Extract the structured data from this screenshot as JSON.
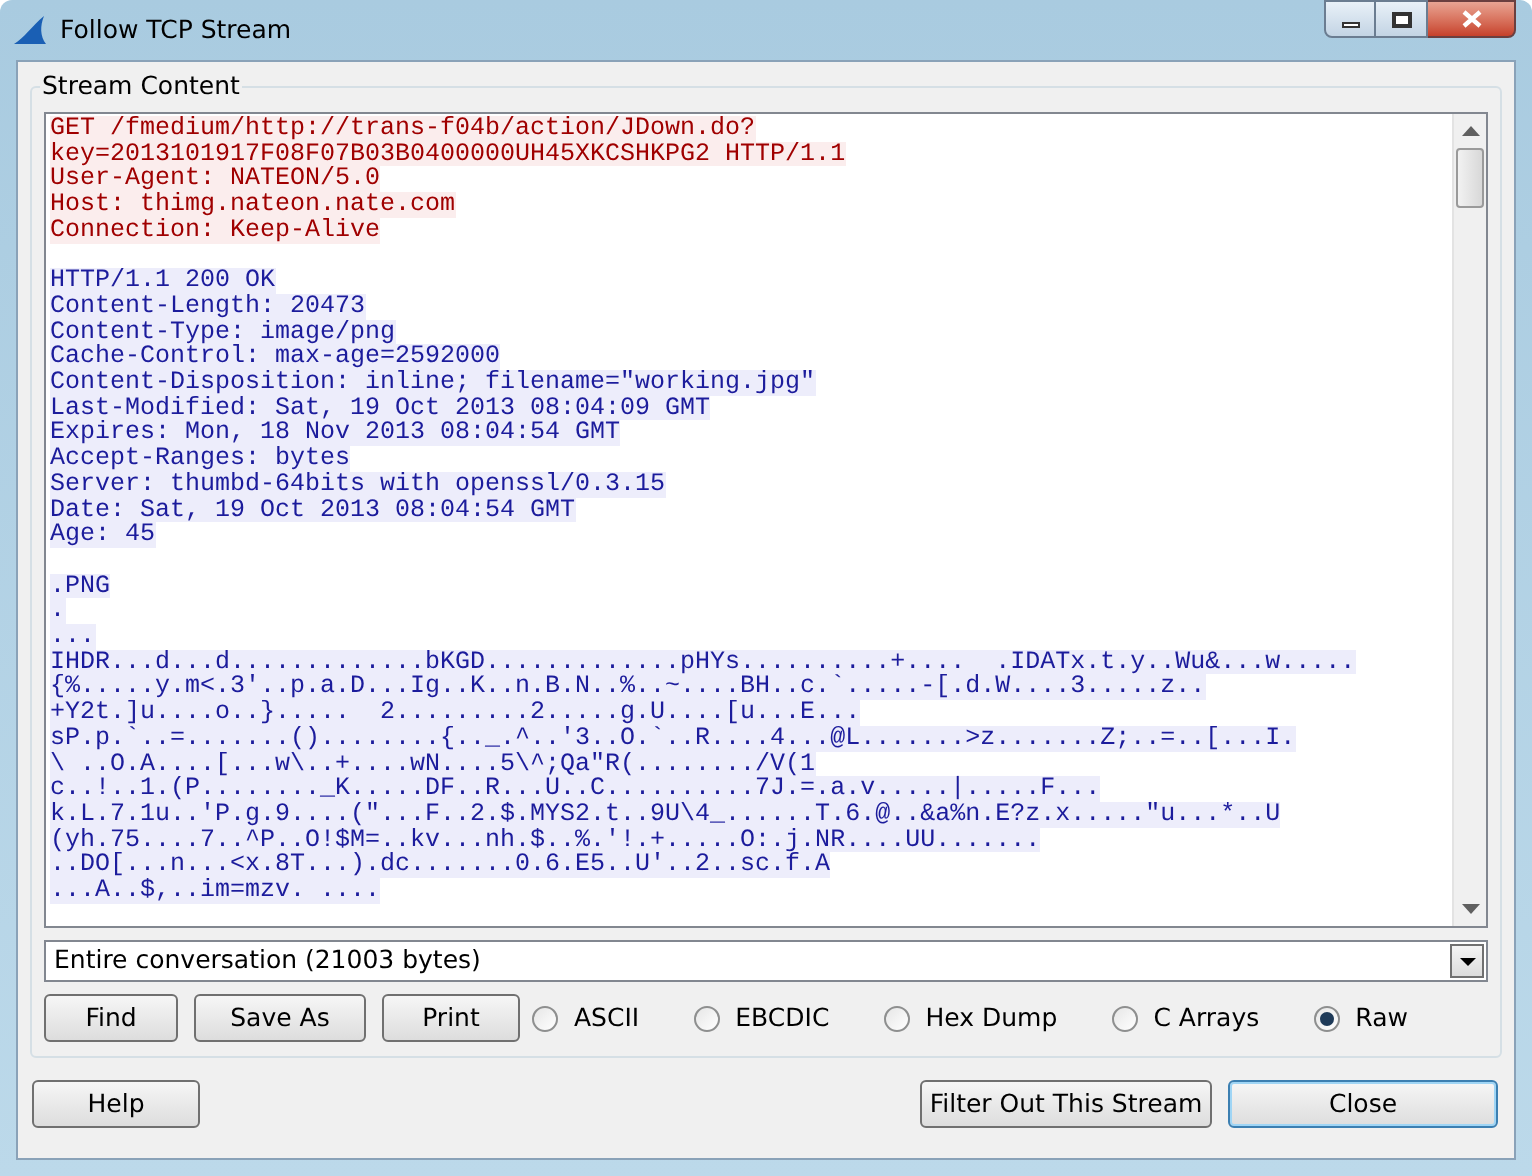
{
  "window": {
    "title": "Follow TCP Stream"
  },
  "stream_content": {
    "title": "Stream Content",
    "segments": [
      {
        "kind": "client",
        "lines": [
          "GET /fmedium/http://trans-f04b/action/JDown.do?",
          "key=2013101917F08F07B03B0400000UH45XKCSHKPG2 HTTP/1.1",
          "User-Agent: NATEON/5.0",
          "Host: thimg.nateon.nate.com",
          "Connection: Keep-Alive"
        ]
      },
      {
        "kind": "server",
        "lines": [
          "HTTP/1.1 200 OK",
          "Content-Length: 20473",
          "Content-Type: image/png",
          "Cache-Control: max-age=2592000",
          "Content-Disposition: inline; filename=\"working.jpg\"",
          "Last-Modified: Sat, 19 Oct 2013 08:04:09 GMT",
          "Expires: Mon, 18 Nov 2013 08:04:54 GMT",
          "Accept-Ranges: bytes",
          "Server: thumbd-64bits with openssl/0.3.15",
          "Date: Sat, 19 Oct 2013 08:04:54 GMT",
          "Age: 45"
        ]
      },
      {
        "kind": "server",
        "lines": [
          ".PNG",
          ".",
          "...",
          "IHDR...d...d.............bKGD.............pHYs..........+....  .IDATx.t.y..Wu&...w.....",
          "{%.....y.m<.3'..p.a.D...Ig..K..n.B.N..%..~....BH..c.`.....-[.d.W....3.....z..",
          "+Y2t.]u....o..}.....  2.........2.....g.U....[u...E...",
          "sP.p.`..=.......()........{.._.^..'3..O.`..R....4...@L.......>z.......Z;..=..[...I.",
          "\\ ..O.A....[...w\\..+....wN....5\\^;Qa\"R(......../V(1",
          "c..!..1.(P........_K.....DF..R...U..C..........7J.=.a.v.....|.....F...",
          "k.L.7.1u..'P.g.9....(\"...F..2.$.MYS2.t..9U\\4_......T.6.@..&a%n.E?z.x.....\"u...*..U",
          "(yh.75....7..^P..O!$M=..kv...nh.$..%.'!.+.....O:.j.NR....UU.......",
          "..DO[...n...<x.8T...).dc.......0.6.E5..U'..2..sc.f.A",
          "...A..$,..im=mzv. ...."
        ]
      }
    ],
    "conversation_select": {
      "value": "Entire conversation (21003 bytes)"
    },
    "buttons": [
      "Find",
      "Save As",
      "Print"
    ],
    "formats": [
      {
        "label": "ASCII",
        "selected": false
      },
      {
        "label": "EBCDIC",
        "selected": false
      },
      {
        "label": "Hex Dump",
        "selected": false
      },
      {
        "label": "C Arrays",
        "selected": false
      },
      {
        "label": "Raw",
        "selected": true
      }
    ]
  },
  "footer": {
    "help": "Help",
    "filter": "Filter Out This Stream",
    "close": "Close"
  }
}
